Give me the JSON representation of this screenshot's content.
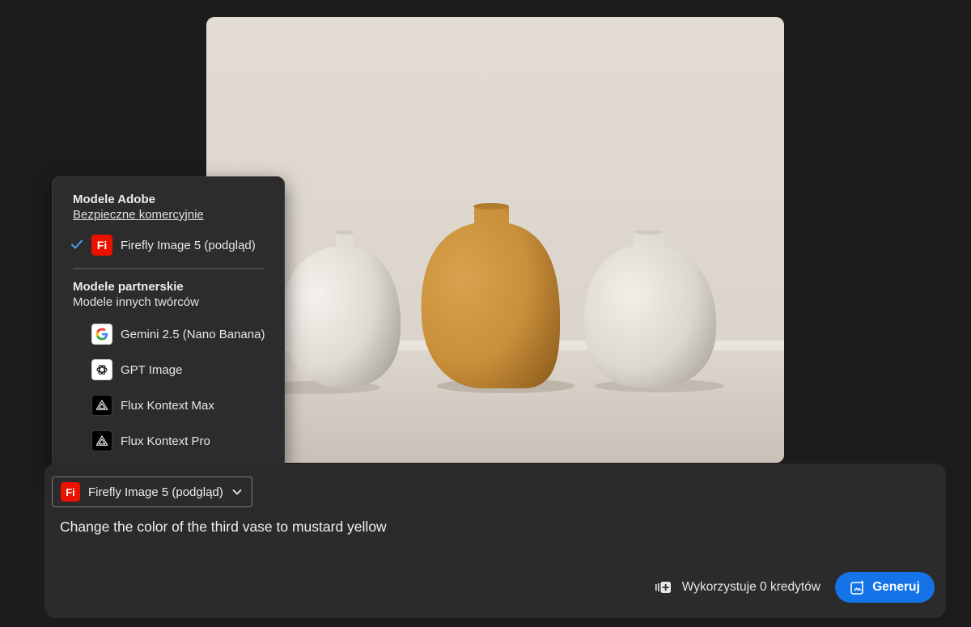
{
  "image": {
    "alt": ""
  },
  "dropdown": {
    "adobe_section": {
      "title": "Modele Adobe",
      "subtitle": "Bezpieczne komercyjnie"
    },
    "adobe_items": [
      {
        "label": "Firefly Image 5 (podgląd)",
        "icon": "firefly-icon",
        "icon_text": "Fi",
        "selected": true
      }
    ],
    "partner_section": {
      "title": "Modele partnerskie",
      "subtitle": "Modele innych twórców"
    },
    "partner_items": [
      {
        "label": "Gemini 2.5 (Nano Banana)",
        "icon": "google-icon"
      },
      {
        "label": "GPT Image",
        "icon": "openai-icon"
      },
      {
        "label": "Flux Kontext Max",
        "icon": "flux-icon"
      },
      {
        "label": "Flux Kontext Pro",
        "icon": "flux-icon"
      }
    ]
  },
  "composer": {
    "model_picker": {
      "label": "Firefly Image 5 (podgląd)",
      "icon_text": "Fi"
    },
    "prompt": "Change the color of the third vase to mustard yellow",
    "credits_text": "Wykorzystuje 0 kredytów",
    "generate_label": "Generuj"
  },
  "colors": {
    "background": "#1c1c1c",
    "panel": "#2b2b2b",
    "accent": "#1473e6",
    "adobe_red": "#eb1000",
    "check": "#4b9cf5"
  }
}
